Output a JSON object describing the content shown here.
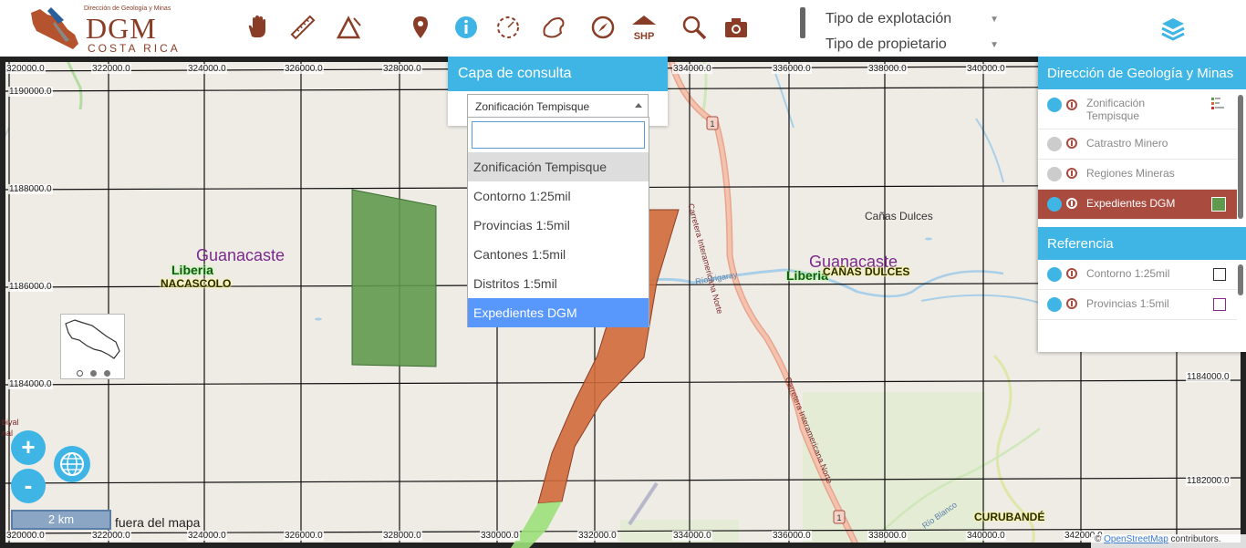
{
  "header": {
    "logo": {
      "small_text": "Dirección de Geología y Minas",
      "main_text": "DGM",
      "sub_text": "COSTA RICA"
    },
    "tools": [
      {
        "name": "pan-hand",
        "icon": "hand-icon"
      },
      {
        "name": "measure-distance",
        "icon": "ruler-icon"
      },
      {
        "name": "measure-area",
        "icon": "triangle-ruler-icon"
      },
      {
        "name": "locate-point",
        "icon": "map-pin-icon"
      },
      {
        "name": "info",
        "icon": "info-icon"
      },
      {
        "name": "draw-circle",
        "icon": "dashed-circle-icon"
      },
      {
        "name": "draw-polygon",
        "icon": "polygon-icon"
      },
      {
        "name": "compass",
        "icon": "compass-icon"
      },
      {
        "name": "shp-export",
        "icon": "shp-house-icon",
        "label": "SHP"
      },
      {
        "name": "search",
        "icon": "magnifier-icon"
      },
      {
        "name": "screenshot",
        "icon": "camera-icon"
      }
    ],
    "filters": {
      "explotacion": "Tipo de explotación",
      "propietario": "Tipo de propietario"
    }
  },
  "consulta": {
    "title": "Capa de consulta",
    "selected": "Zonificación Tempisque",
    "search_value": "",
    "options": [
      "Zonificación Tempisque",
      "Contorno 1:25mil",
      "Provincias 1:5mil",
      "Cantones 1:5mil",
      "Distritos 1:5mil",
      "Expedientes DGM"
    ],
    "highlighted_option": "Expedientes DGM"
  },
  "layer_panel": {
    "title": "Dirección de Geología y Minas",
    "layers": [
      {
        "name": "Zonificación Tempisque",
        "visible": true
      },
      {
        "name": "Catrastro Minero",
        "visible": false
      },
      {
        "name": "Regiones Mineras",
        "visible": false
      },
      {
        "name": "Expedientes DGM",
        "visible": true,
        "active": true
      }
    ],
    "reference_title": "Referencia",
    "reference_layers": [
      {
        "name": "Contorno 1:25mil",
        "visible": true
      },
      {
        "name": "Provincias 1:5mil",
        "visible": true
      }
    ]
  },
  "map": {
    "x_coords": [
      "320000.0",
      "322000.0",
      "324000.0",
      "326000.0",
      "328000.0",
      "334000.0",
      "336000.0",
      "338000.0",
      "340000.0"
    ],
    "x_coords_bottom": [
      "320000.0",
      "322000.0",
      "324000.0",
      "326000.0",
      "328000.0",
      "330000.0",
      "332000.0",
      "334000.0",
      "336000.0",
      "338000.0",
      "340000.0",
      "342000.0"
    ],
    "y_coords": [
      "1190000.0",
      "1188000.0",
      "1186000.0",
      "1184000.0",
      "1182000.0"
    ],
    "y_coords_right": [
      "1184000.0",
      "1182000.0"
    ],
    "places": {
      "guanacaste_left": "Guanacaste",
      "liberia_left": "Liberia",
      "nacascolo": "NACASCOLO",
      "guanacaste_right": "Guanacaste",
      "liberia_right": "Liberia",
      "canas_dulces_upper": "CAÑAS DULCES",
      "canas_dulces": "Cañas Dulces",
      "curubande": "CURUBANDÉ",
      "bival": "biyal",
      "nal": "nal"
    },
    "road_labels": {
      "carretera1": "Carretera Interamericana Norte",
      "carretera2": "Carretera Interamericana Norte",
      "rio_irigaray": "Río Irigaray",
      "rio_blanco": "Río Blanco"
    },
    "route_shield": "1",
    "scale_label": "2 km",
    "out_of_map": "fuera del mapa",
    "attribution_prefix": "©",
    "attribution_link": "OpenStreetMap",
    "attribution_suffix": "contributors."
  },
  "controls": {
    "zoom_in": "+",
    "zoom_out": "-"
  },
  "colors": {
    "accent": "#3fb5e5",
    "brand": "#8a3d26",
    "active_layer": "#a94b3f",
    "expediente_green": "#5f9a4e",
    "expediente_orange": "#d06b3a"
  }
}
